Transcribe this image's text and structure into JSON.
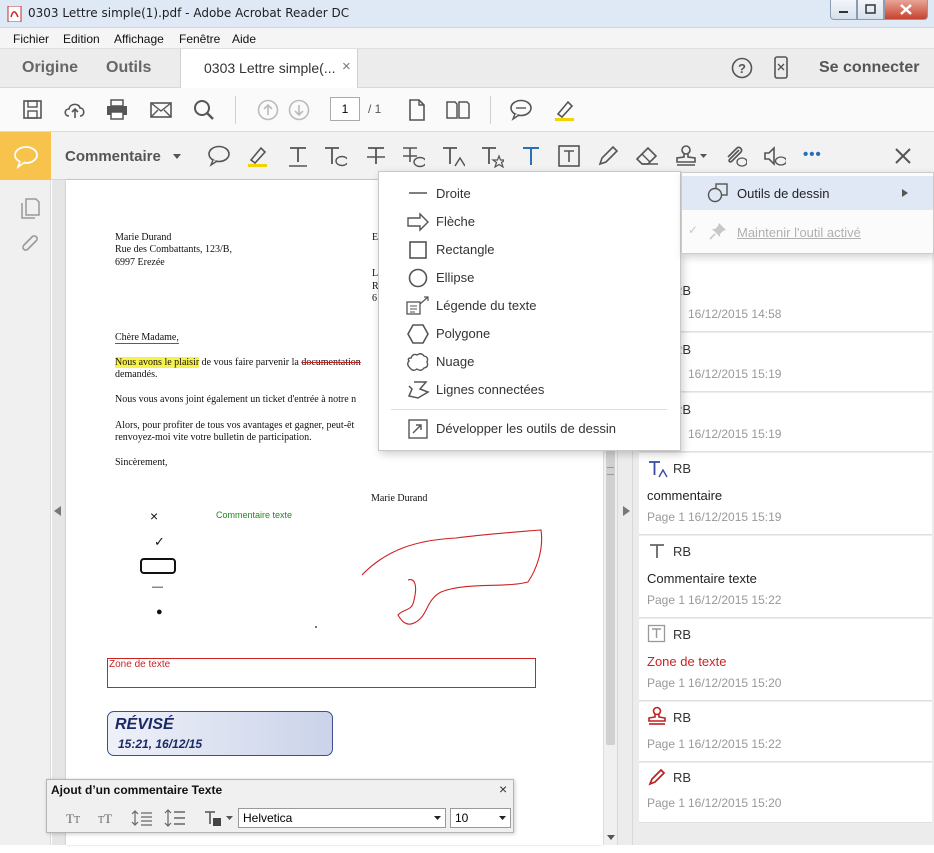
{
  "window": {
    "title": "0303 Lettre simple(1).pdf - Adobe Acrobat Reader DC"
  },
  "menu": {
    "items": [
      "Fichier",
      "Edition",
      "Affichage",
      "Fenêtre",
      "Aide"
    ]
  },
  "tabs": {
    "home": "Origine",
    "tools": "Outils",
    "doc": "0303 Lettre simple(...",
    "close": "×",
    "signin": "Se connecter"
  },
  "toolbar": {
    "page_current": "1",
    "page_total": "/ 1"
  },
  "comment_bar": {
    "label": "Commentaire",
    "more": "•••"
  },
  "letter": {
    "sender_name": "Marie Durand",
    "sender_street": "Rue des Combattants, 123/B,",
    "sender_city": "6997 Erezée",
    "right_e": "E",
    "right_l": "L",
    "right_r": "R",
    "right_6": "6",
    "salutation": "Chère Madame,",
    "p1_hl": "Nous avons le plaisir",
    "p1_mid": " de vous faire parvenir la ",
    "p1_strike": "documentation",
    "p1_end": "demandés.",
    "p2": "Nous vous avons joint également un ticket d'entrée à notre n",
    "p3a": "Alors, pour profiter de tous vos avantages et gagner, peut-êt",
    "p3b": "renvoyez-moi vite votre bulletin de participation.",
    "closing": "Sincèrement,",
    "signature": "Marie Durand",
    "inline_comment": "Commentaire texte",
    "textbox": "Zone de texte",
    "stamp_title": "RÉVISÉ",
    "stamp_time": "15:21, 16/12/15",
    "symbol_x": "×",
    "symbol_check": "✓",
    "symbol_dash": "—",
    "symbol_dot": "●"
  },
  "draw_menu": {
    "items": [
      {
        "label": "Droite",
        "icon": "line-icon"
      },
      {
        "label": "Flèche",
        "icon": "arrow-icon"
      },
      {
        "label": "Rectangle",
        "icon": "rectangle-icon"
      },
      {
        "label": "Ellipse",
        "icon": "ellipse-icon"
      },
      {
        "label": "Légende du texte",
        "icon": "text-callout-icon"
      },
      {
        "label": "Polygone",
        "icon": "polygon-icon"
      },
      {
        "label": "Nuage",
        "icon": "cloud-icon"
      },
      {
        "label": "Lignes connectées",
        "icon": "polyline-icon"
      }
    ],
    "expand": "Développer les outils de dessin"
  },
  "submenu": {
    "drawing_tools": "Outils de dessin",
    "keep_active": "Maintenir l'outil activé"
  },
  "comments": [
    {
      "author": "RB",
      "date": "16/12/2015 14:58",
      "icon": "highlight-icon"
    },
    {
      "author": "RB",
      "date": "16/12/2015 15:19",
      "icon": "note-icon"
    },
    {
      "author": "RB",
      "date": "16/12/2015 15:19",
      "icon": "note-icon"
    },
    {
      "author": "RB",
      "body": "commentaire",
      "page": "Page 1",
      "date": "16/12/2015 15:19",
      "icon": "insert-text-icon"
    },
    {
      "author": "RB",
      "body": "Commentaire texte",
      "page": "Page 1",
      "date": "16/12/2015 15:22",
      "icon": "text-comment-icon"
    },
    {
      "author": "RB",
      "body": "Zone de texte",
      "page": "Page 1",
      "date": "16/12/2015 15:20",
      "icon": "textbox-icon"
    },
    {
      "author": "RB",
      "page": "Page 1",
      "date": "16/12/2015 15:22",
      "icon": "stamp-icon"
    },
    {
      "author": "RB",
      "page": "Page 1",
      "date": "16/12/2015 15:20",
      "icon": "pencil-icon"
    }
  ],
  "text_props": {
    "title": "Ajout d’un commentaire Texte",
    "close": "×",
    "font": "Helvetica",
    "size": "10"
  },
  "colors": {
    "accent": "#f7c34c",
    "ink_red": "#cc2222",
    "link_green": "#1d8a1d",
    "blue": "#2b6fb6"
  }
}
